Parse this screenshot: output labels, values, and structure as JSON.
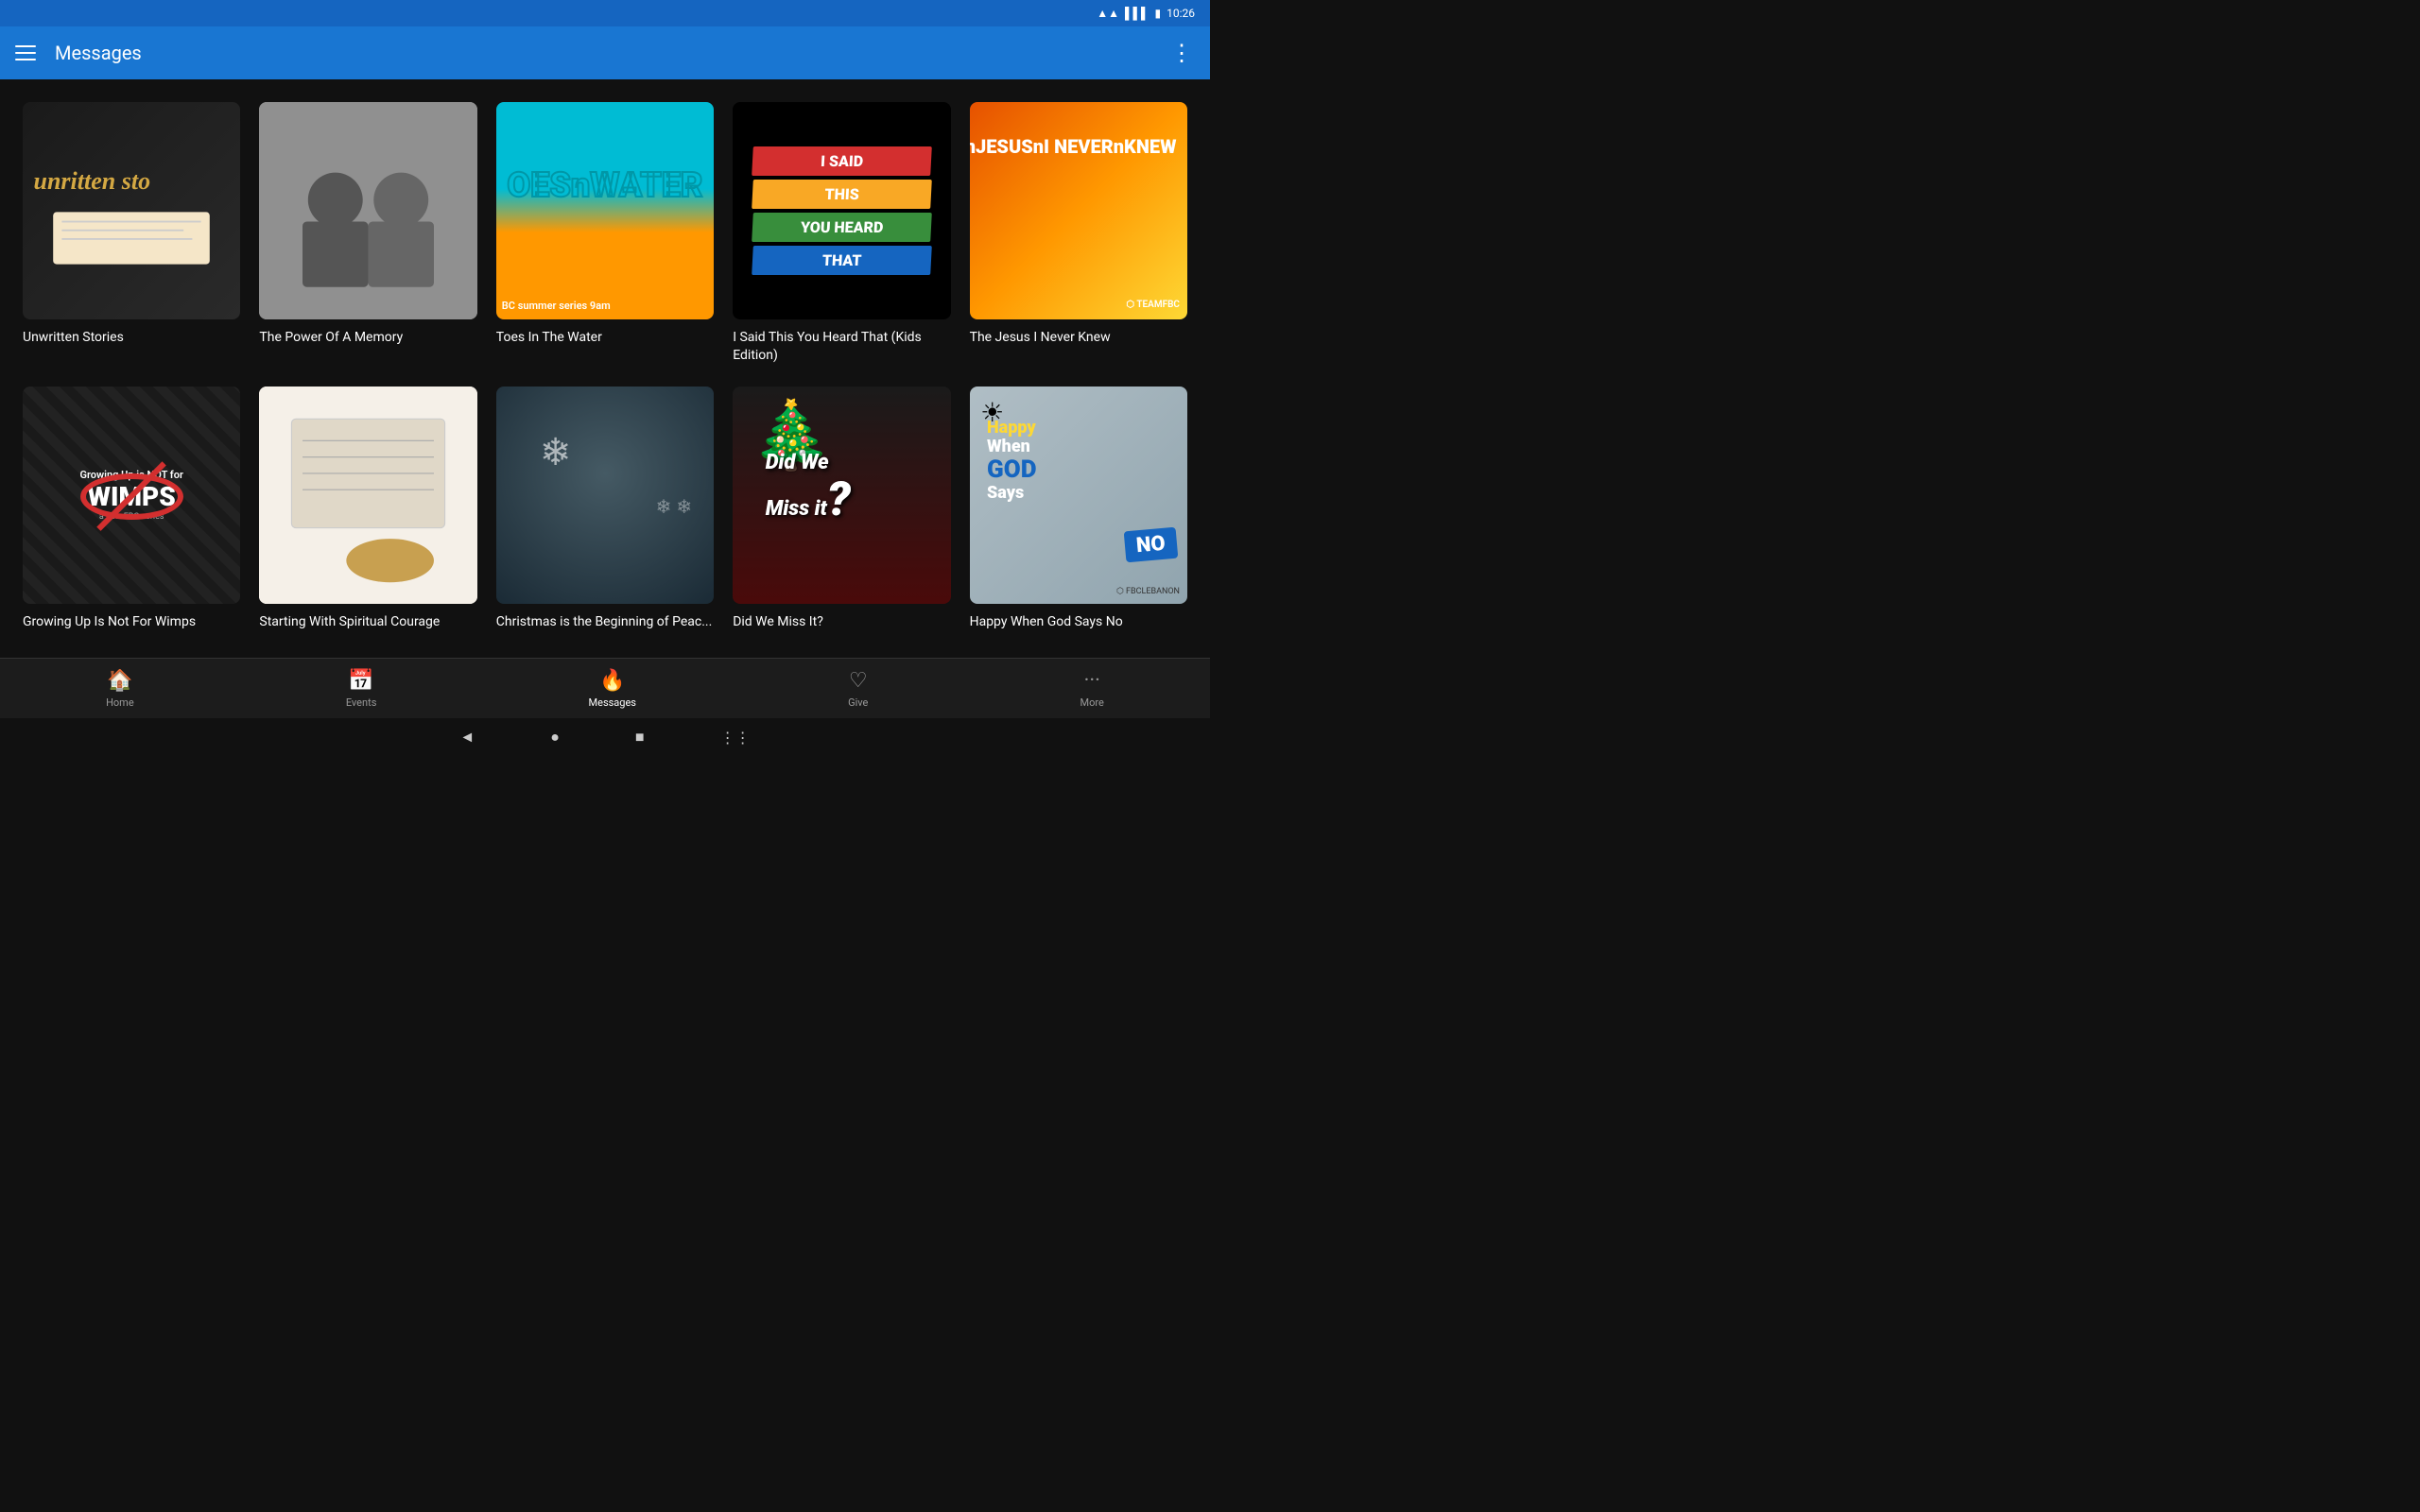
{
  "statusBar": {
    "time": "10:26",
    "wifiIcon": "wifi",
    "signalIcon": "signal",
    "batteryIcon": "battery"
  },
  "appBar": {
    "title": "Messages",
    "menuIcon": "hamburger-menu",
    "moreIcon": "more-vertical"
  },
  "grid": {
    "row1": [
      {
        "id": "unwritten-stories",
        "title": "Unwritten Stories",
        "imageType": "unwritten"
      },
      {
        "id": "power-of-memory",
        "title": "The Power Of A Memory",
        "imageType": "memory"
      },
      {
        "id": "toes-in-water",
        "title": "Toes In The Water",
        "imageType": "toes"
      },
      {
        "id": "i-said-this",
        "title": "I Said This You Heard That (Kids Edition)",
        "imageType": "isaid"
      },
      {
        "id": "jesus-i-never-knew",
        "title": "The Jesus I Never Knew",
        "imageType": "jesus"
      }
    ],
    "row2": [
      {
        "id": "growing-up-wimps",
        "title": "Growing Up Is Not For Wimps",
        "imageType": "wimps"
      },
      {
        "id": "starting-spiritual",
        "title": "Starting With Spiritual Courage",
        "imageType": "spiritual"
      },
      {
        "id": "christmas-beginning",
        "title": "Christmas is the Beginning of Peac...",
        "imageType": "christmas"
      },
      {
        "id": "did-we-miss-it",
        "title": "Did We Miss It?",
        "imageType": "didwemiss"
      },
      {
        "id": "happy-when-god-says",
        "title": "Happy When God Says No",
        "imageType": "happy"
      }
    ]
  },
  "isaidBanners": [
    "I SAID",
    "THIS",
    "YOU HEARD",
    "THAT"
  ],
  "bottomNav": {
    "items": [
      {
        "id": "home",
        "label": "Home",
        "icon": "🏠",
        "active": false
      },
      {
        "id": "events",
        "label": "Events",
        "icon": "📅",
        "active": false
      },
      {
        "id": "messages",
        "label": "Messages",
        "icon": "🔥",
        "active": true
      },
      {
        "id": "give",
        "label": "Give",
        "icon": "♡",
        "active": false
      },
      {
        "id": "more",
        "label": "More",
        "icon": "···",
        "active": false
      }
    ]
  },
  "sysNav": {
    "back": "◄",
    "home": "●",
    "recents": "■",
    "grid": "⋮⋮"
  }
}
